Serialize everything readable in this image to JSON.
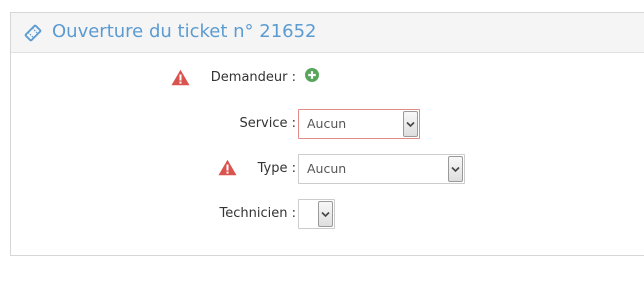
{
  "header": {
    "title": "Ouverture du ticket n° 21652"
  },
  "form": {
    "requester": {
      "label": "Demandeur :",
      "required": true
    },
    "service": {
      "label": "Service :",
      "value": "Aucun"
    },
    "type": {
      "label": "Type :",
      "value": "Aucun",
      "required": true
    },
    "technician": {
      "label": "Technicien :",
      "value": ""
    }
  },
  "icons": {
    "title_icon": "ticket-icon",
    "warning": "warning-triangle-icon",
    "add": "plus-circle-icon",
    "dropdown": "chevron-down-icon"
  },
  "colors": {
    "title": "#5b9bd1",
    "warning": "#d9534f",
    "add": "#58a65c",
    "error_border": "#e08a8a"
  }
}
